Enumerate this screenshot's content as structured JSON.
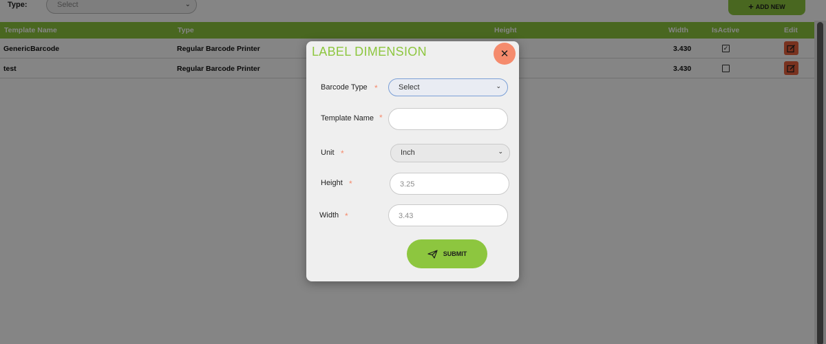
{
  "filter": {
    "label": "Type:",
    "select_value": "Select"
  },
  "toolbar": {
    "add_new_label": "ADD NEW"
  },
  "grid": {
    "columns": [
      "Template Name",
      "Type",
      "Height",
      "Width",
      "IsActive",
      "Edit"
    ],
    "rows": [
      {
        "template_name": "GenericBarcode",
        "type": "Regular Barcode Printer",
        "width": "3.430",
        "is_active": true
      },
      {
        "template_name": "test",
        "type": "Regular Barcode Printer",
        "width": "3.430",
        "is_active": false
      }
    ]
  },
  "modal": {
    "title": "LABEL DIMENSION",
    "barcode_type": {
      "label": "Barcode Type",
      "value": "Select"
    },
    "template_name": {
      "label": "Template Name",
      "value": ""
    },
    "unit": {
      "label": "Unit",
      "value": "Inch"
    },
    "height": {
      "label": "Height",
      "value": "3.25"
    },
    "width": {
      "label": "Width",
      "value": "3.43"
    },
    "required_mark": "*",
    "submit_label": "SUBMIT"
  },
  "colors": {
    "accent_green": "#8dc63f",
    "close_coral": "#f58b6d",
    "edit_orange": "#e8603c"
  }
}
